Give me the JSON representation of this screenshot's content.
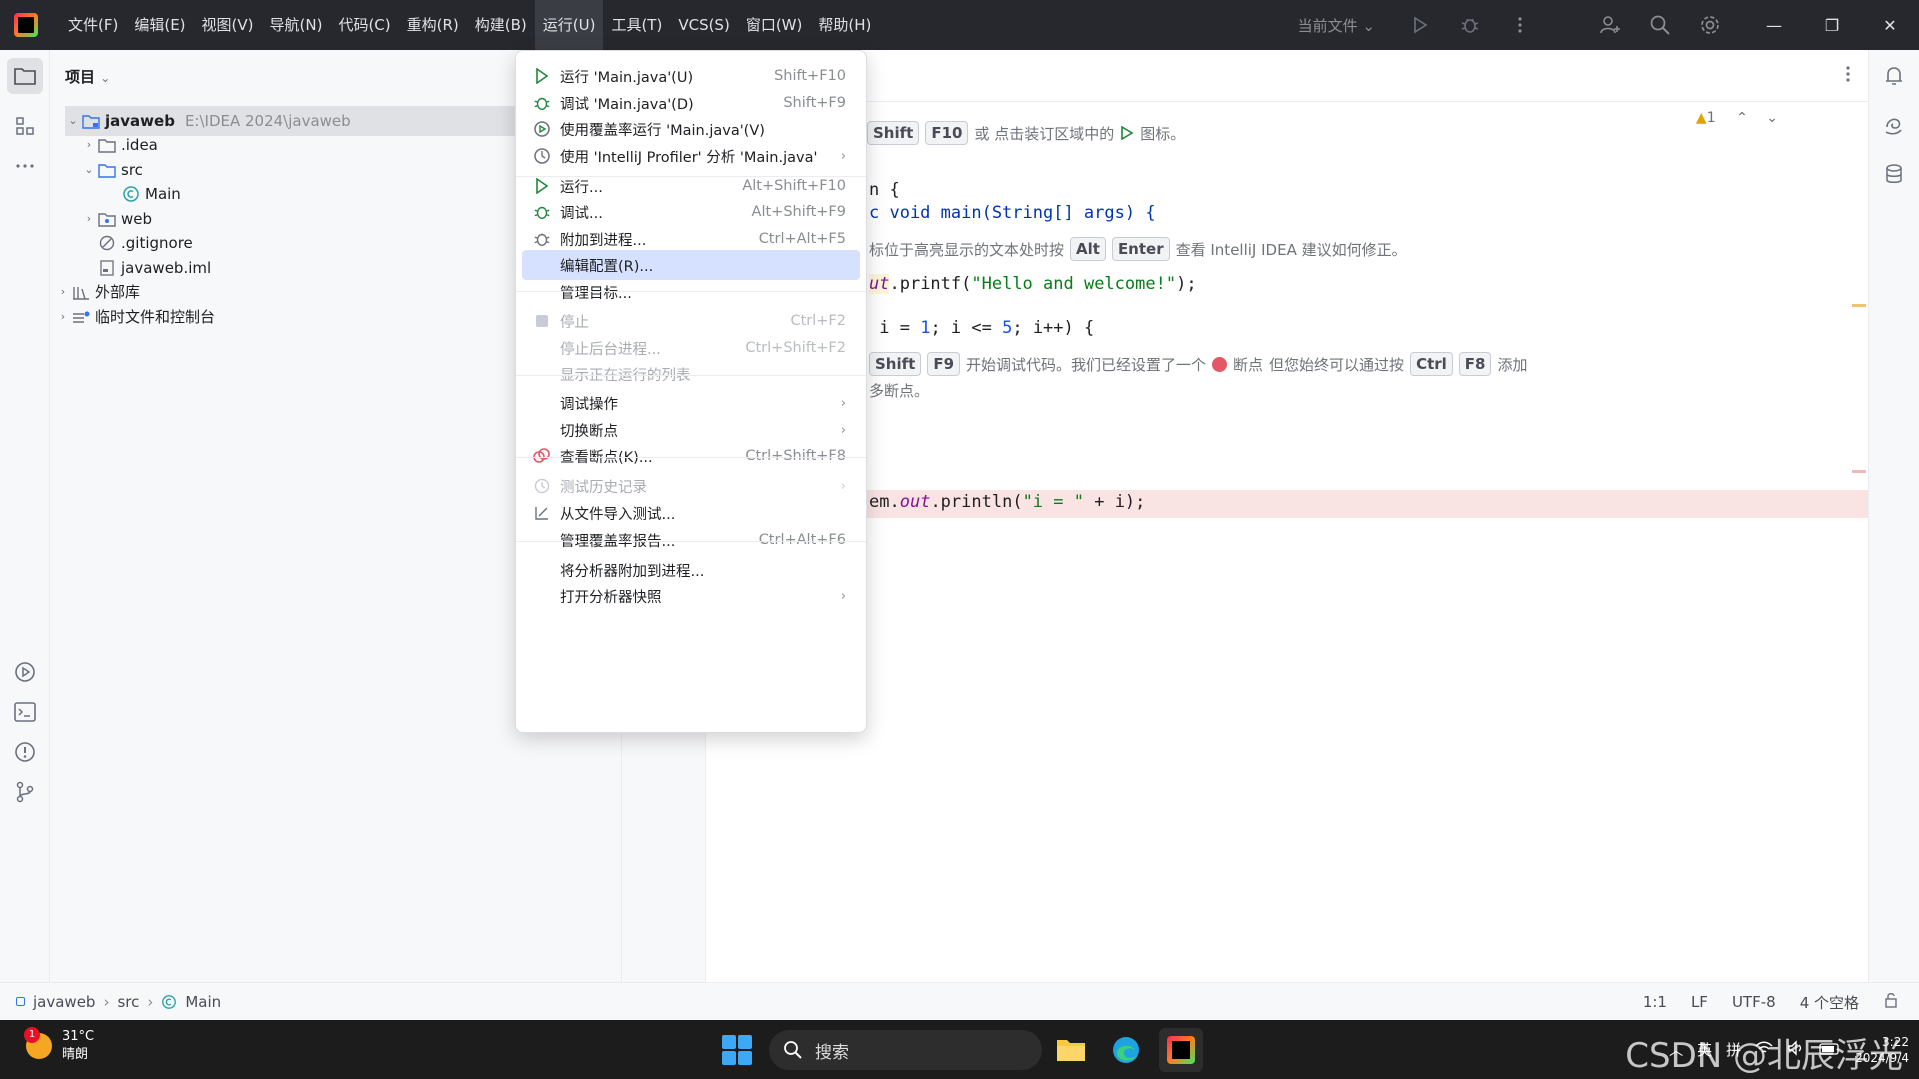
{
  "menubar": [
    "文件(F)",
    "编辑(E)",
    "视图(V)",
    "导航(N)",
    "代码(C)",
    "重构(R)",
    "构建(B)",
    "运行(U)",
    "工具(T)",
    "VCS(S)",
    "窗口(W)",
    "帮助(H)"
  ],
  "toolbar": {
    "current_file": "当前文件"
  },
  "project": {
    "header": "项目",
    "root_name": "javaweb",
    "root_path": "E:\\IDEA 2024\\javaweb",
    "items": [
      ".idea",
      "src",
      "Main",
      "web",
      ".gitignore",
      "javaweb.iml",
      "外部库",
      "临时文件和控制台"
    ]
  },
  "editor": {
    "hint1": {
      "pre": "Shift",
      "key": "F10",
      "text": "或 点击装订区域中的",
      "tail": "图标。"
    },
    "code1": "n {",
    "code2a": "c void main(String[] args) {",
    "hint2": {
      "pre": "标位于高亮显示的文本处时按",
      "k1": "Alt",
      "k2": "Enter",
      "tail": "查看 IntelliJ IDEA 建议如何修正。"
    },
    "code3_fld": "ut",
    "code3_rest": ".printf(",
    "code3_str": "\"Hello and welcome!\"",
    "code3_end": ");",
    "code4_pre": " i = ",
    "code4_n1": "1",
    "code4_mid": "; i <= ",
    "code4_n2": "5",
    "code4_end": "; i++) {",
    "hint3": {
      "k1": "Shift",
      "k2": "F9",
      "text": "开始调试代码。我们已经设置了一个",
      "bp": "断点",
      "text2": "但您始终可以通过按",
      "k3": "Ctrl",
      "k4": "F8",
      "tail": "添加"
    },
    "hint3b": "多断点。",
    "code5_pre": "em.",
    "code5_fld": "out",
    "code5_mid": ".println(",
    "code5_str": "\"i = \"",
    "code5_end": " + i);",
    "warn": "1"
  },
  "run_menu": {
    "items": [
      {
        "label": "运行 'Main.java'(U)",
        "shortcut": "Shift+F10"
      },
      {
        "label": "调试 'Main.java'(D)",
        "shortcut": "Shift+F9"
      },
      {
        "label": "使用覆盖率运行 'Main.java'(V)",
        "shortcut": ""
      },
      {
        "label": "使用 'IntelliJ Profiler' 分析 'Main.java'",
        "shortcut": ""
      },
      {
        "label": "运行...",
        "shortcut": "Alt+Shift+F10"
      },
      {
        "label": "调试...",
        "shortcut": "Alt+Shift+F9"
      },
      {
        "label": "附加到进程...",
        "shortcut": "Ctrl+Alt+F5"
      },
      {
        "label": "编辑配置(R)...",
        "shortcut": ""
      },
      {
        "label": "管理目标...",
        "shortcut": ""
      },
      {
        "label": "停止",
        "shortcut": "Ctrl+F2"
      },
      {
        "label": "停止后台进程...",
        "shortcut": "Ctrl+Shift+F2"
      },
      {
        "label": "显示正在运行的列表",
        "shortcut": ""
      },
      {
        "label": "调试操作",
        "shortcut": ""
      },
      {
        "label": "切换断点",
        "shortcut": ""
      },
      {
        "label": "查看断点(K)...",
        "shortcut": "Ctrl+Shift+F8"
      },
      {
        "label": "测试历史记录",
        "shortcut": ""
      },
      {
        "label": "从文件导入测试...",
        "shortcut": ""
      },
      {
        "label": "管理覆盖率报告...",
        "shortcut": "Ctrl+Alt+F6"
      },
      {
        "label": "将分析器附加到进程...",
        "shortcut": ""
      },
      {
        "label": "打开分析器快照",
        "shortcut": ""
      }
    ]
  },
  "statusbar": {
    "breadcrumbs": [
      "javaweb",
      "src",
      "Main"
    ],
    "position": "1:1",
    "line_sep": "LF",
    "encoding": "UTF-8",
    "indent": "4 个空格"
  },
  "taskbar": {
    "temp": "31°C",
    "weather": "晴朗",
    "badge": "1",
    "search": "搜索",
    "ime": "英",
    "ime2": "拼",
    "time": "3:22",
    "date": "2024/9/4",
    "watermark": "CSDN @北辰浮光"
  }
}
